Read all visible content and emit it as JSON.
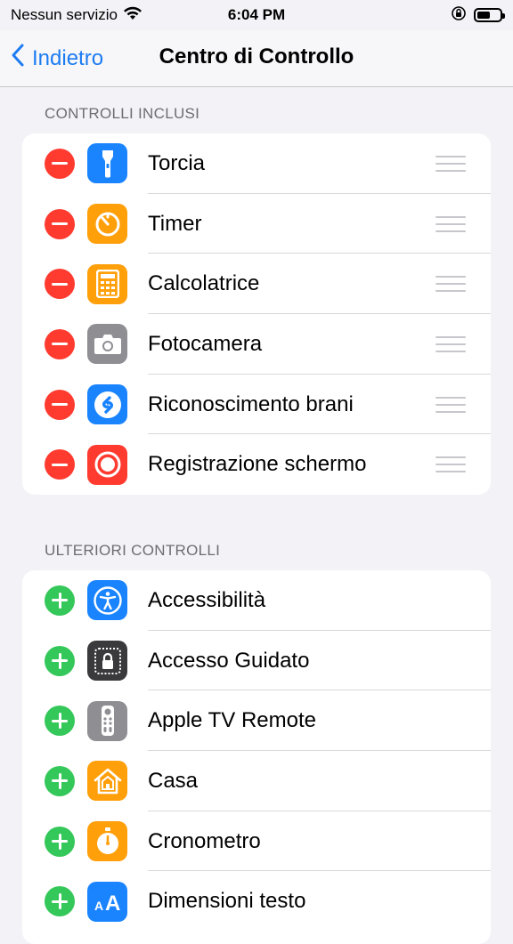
{
  "status_bar": {
    "carrier": "Nessun servizio",
    "time": "6:04 PM"
  },
  "nav": {
    "back_label": "Indietro",
    "title": "Centro di Controllo"
  },
  "included": {
    "header": "CONTROLLI INCLUSI",
    "items": [
      {
        "label": "Torcia",
        "icon": "flashlight-icon",
        "color": "#1a84ff"
      },
      {
        "label": "Timer",
        "icon": "timer-icon",
        "color": "#ff9f0a"
      },
      {
        "label": "Calcolatrice",
        "icon": "calculator-icon",
        "color": "#ff9f0a"
      },
      {
        "label": "Fotocamera",
        "icon": "camera-icon",
        "color": "#8e8e93"
      },
      {
        "label": "Riconoscimento brani",
        "icon": "shazam-icon",
        "color": "#1a84ff"
      },
      {
        "label": "Registrazione schermo",
        "icon": "screen-recording-icon",
        "color": "#ff3b30"
      }
    ]
  },
  "more": {
    "header": "ULTERIORI CONTROLLI",
    "items": [
      {
        "label": "Accessibilità",
        "icon": "accessibility-icon",
        "color": "#1a84ff"
      },
      {
        "label": "Accesso Guidato",
        "icon": "guided-access-icon",
        "color": "#3a3a3c"
      },
      {
        "label": "Apple TV Remote",
        "icon": "tv-remote-icon",
        "color": "#8e8e93"
      },
      {
        "label": "Casa",
        "icon": "home-icon",
        "color": "#ff9f0a"
      },
      {
        "label": "Cronometro",
        "icon": "stopwatch-icon",
        "color": "#ff9f0a"
      },
      {
        "label": "Dimensioni testo",
        "icon": "text-size-icon",
        "color": "#1a84ff"
      }
    ]
  }
}
